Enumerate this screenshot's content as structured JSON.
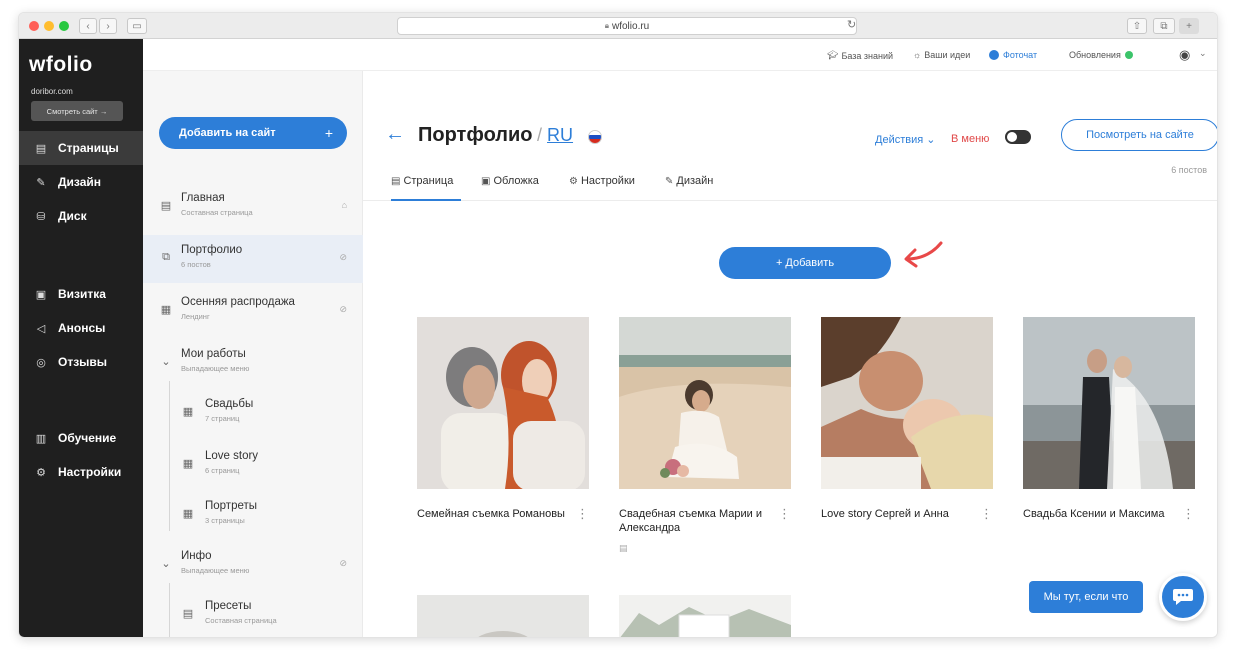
{
  "browser": {
    "url": "wfolio.ru",
    "lock_icon": "lock-icon",
    "traffic_lights": [
      "#ff5f57",
      "#ffbd2e",
      "#28c840"
    ]
  },
  "sidebar": {
    "logo": "wfolio",
    "domain": "doribor.com",
    "view_site": "Смотреть сайт →",
    "items": [
      {
        "label": "Страницы",
        "icon": "document-icon"
      },
      {
        "label": "Дизайн",
        "icon": "brush-icon"
      },
      {
        "label": "Диск",
        "icon": "database-icon"
      },
      {
        "label": "Визитка",
        "icon": "card-icon"
      },
      {
        "label": "Анонсы",
        "icon": "megaphone-icon"
      },
      {
        "label": "Отзывы",
        "icon": "chat-bubbles-icon"
      },
      {
        "label": "Обучение",
        "icon": "book-icon"
      },
      {
        "label": "Настройки",
        "icon": "gear-icon"
      }
    ]
  },
  "topbar": {
    "knowledge": "База знаний",
    "ideas": "Ваши идеи",
    "photochat": "Фоточат",
    "updates": "Обновления"
  },
  "pages_panel": {
    "add_button": "Добавить на сайт",
    "add_plus": "+",
    "items": [
      {
        "title": "Главная",
        "subtitle": "Составная страница"
      },
      {
        "title": "Портфолио",
        "subtitle": "6 постов"
      },
      {
        "title": "Осенняя распродажа",
        "subtitle": "Лендинг"
      },
      {
        "title": "Мои работы",
        "subtitle": "Выпадающее меню"
      },
      {
        "title": "Свадьбы",
        "subtitle": "7 страниц"
      },
      {
        "title": "Love story",
        "subtitle": "6 страниц"
      },
      {
        "title": "Портреты",
        "subtitle": "3 страницы"
      },
      {
        "title": "Инфо",
        "subtitle": "Выпадающее меню"
      },
      {
        "title": "Пресеты",
        "subtitle": "Составная страница"
      }
    ]
  },
  "main": {
    "back": "←",
    "title": "Портфолио",
    "lang_sep": "/",
    "lang": "RU",
    "actions": "Действия ⌄",
    "in_menu": "В меню",
    "view_site": "Посмотреть на сайте",
    "count": "6 постов",
    "tabs": [
      "Страница",
      "Обложка",
      "Настройки",
      "Дизайн"
    ],
    "add": "+ Добавить"
  },
  "posts": [
    {
      "title": "Семейная съемка Романовы"
    },
    {
      "title": "Свадебная съемка Марии и Александра"
    },
    {
      "title": "Love story Сергей и Анна"
    },
    {
      "title": "Свадьба Ксении и Максима"
    }
  ],
  "chat": {
    "label": "Мы тут, если что"
  },
  "colors": {
    "accent": "#2d7ed8",
    "sidebar_bg": "#1f1f1f",
    "arrow": "#e84848",
    "update_dot": "#3cc46a"
  }
}
